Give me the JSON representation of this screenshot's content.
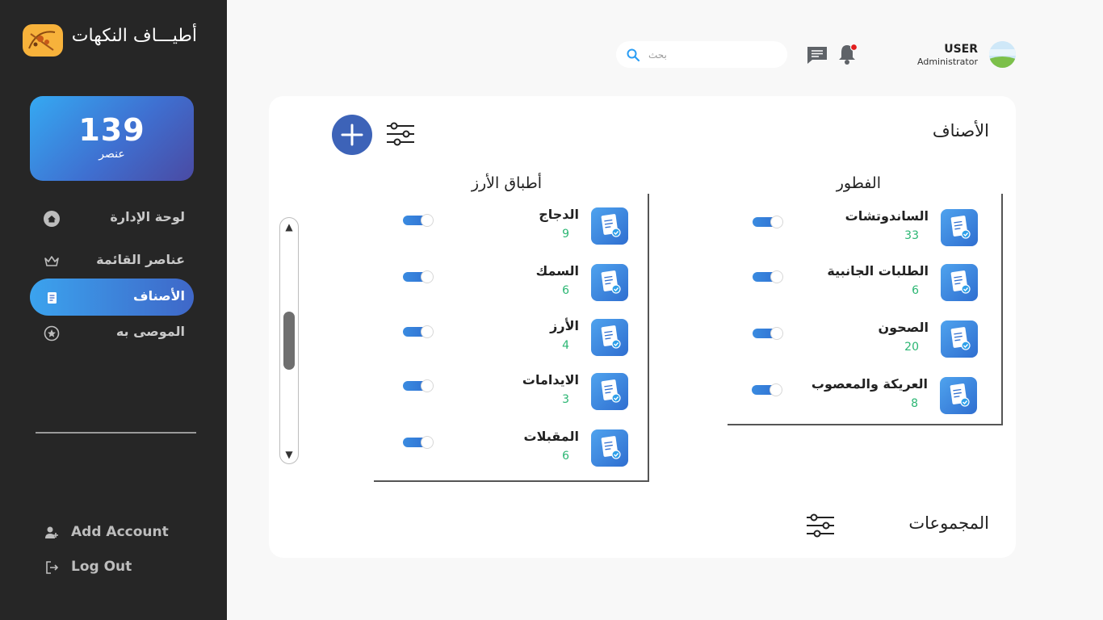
{
  "sidebar": {
    "brand": "أطيـــاف النكهات",
    "count": {
      "value": "139",
      "label": "عنصر"
    },
    "nav": [
      {
        "label": "لوحة الإدارة",
        "icon": "home-icon",
        "active": false
      },
      {
        "label": "عناصر القائمة",
        "icon": "crown-icon",
        "active": false
      },
      {
        "label": "الأصناف",
        "icon": "document-icon",
        "active": true
      },
      {
        "label": "الموصى به",
        "icon": "star-icon",
        "active": false
      }
    ],
    "bottom": [
      {
        "label": "Add Account",
        "icon": "add-user-icon"
      },
      {
        "label": "Log Out",
        "icon": "logout-icon"
      }
    ]
  },
  "header": {
    "search_placeholder": "بحث",
    "user": {
      "name": "USER",
      "role": "Administrator"
    }
  },
  "main": {
    "categories_title": "الأصناف",
    "groups_title": "المجموعات",
    "columns": [
      {
        "title": "الفطور",
        "items": [
          {
            "name": "الساندوتشات",
            "count": "33",
            "enabled": true
          },
          {
            "name": "الطلبات الجانبية",
            "count": "6",
            "enabled": true
          },
          {
            "name": "الصحون",
            "count": "20",
            "enabled": true
          },
          {
            "name": "العريكة والمعصوب",
            "count": "8",
            "enabled": true
          }
        ]
      },
      {
        "title": "أطباق الأرز",
        "items": [
          {
            "name": "الدجاج",
            "count": "9",
            "enabled": true
          },
          {
            "name": "السمك",
            "count": "6",
            "enabled": true
          },
          {
            "name": "الأرز",
            "count": "4",
            "enabled": true
          },
          {
            "name": "الايدامات",
            "count": "3",
            "enabled": true
          },
          {
            "name": "المقبلات",
            "count": "6",
            "enabled": true
          }
        ]
      }
    ]
  },
  "colors": {
    "sidebar_bg": "#262626",
    "accent_blue": "#3d63b8",
    "count_green": "#2bb673",
    "notification_red": "#e11d1d"
  }
}
